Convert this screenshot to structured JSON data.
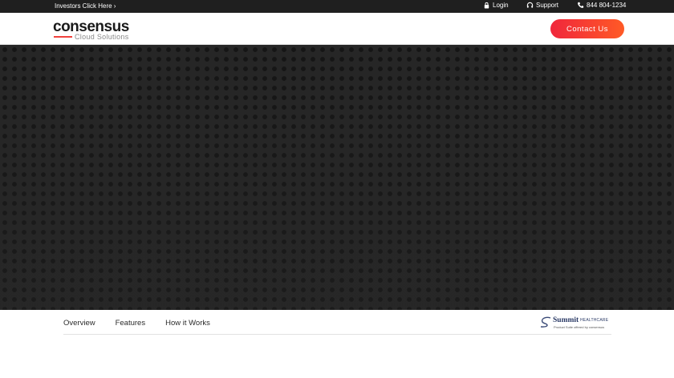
{
  "topbar": {
    "investors": "Investors Click Here ›",
    "login": "Login",
    "support": "Support",
    "phone": "844 804-1234"
  },
  "header": {
    "logo_word": "consensus",
    "logo_sub": "Cloud Solutions",
    "contact": "Contact Us"
  },
  "subnav": {
    "tabs": [
      "Overview",
      "Features",
      "How it Works"
    ],
    "partner_name": "Summit",
    "partner_suffix": "HEALTHCARE",
    "partner_tagline": "Product Suite offered by consensus"
  },
  "colors": {
    "accent": "#f0413c",
    "topbar_bg": "#1f1f1f",
    "hero_bg": "#262626"
  }
}
